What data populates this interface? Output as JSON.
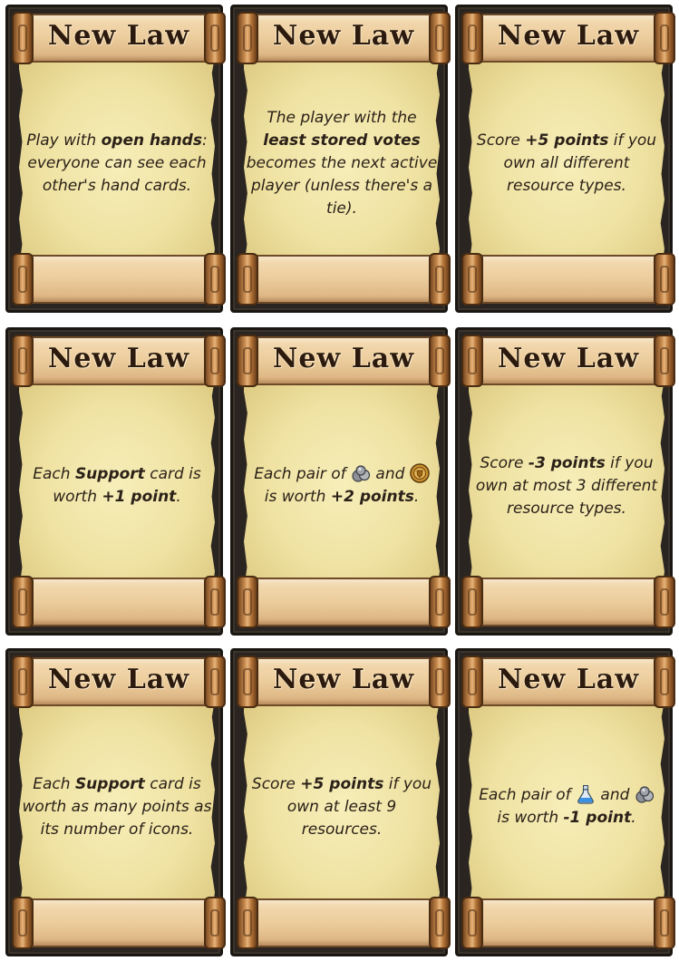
{
  "card_title": "New Law",
  "cards": [
    {
      "id": "c1",
      "t1": "Play with ",
      "b1": "open hands",
      "t2": ": everyone can see each other's hand cards."
    },
    {
      "id": "c2",
      "t1": "The player with the ",
      "b1": "least stored votes",
      "t2": " becomes the next active player (unless there's a tie)."
    },
    {
      "id": "c3",
      "t1": "Score ",
      "b1": "+5 points",
      "t2": " if you own all different resource types."
    },
    {
      "id": "c4",
      "t1": "Each ",
      "b1": "Support",
      "t2": " card is worth ",
      "b2": "+1 point",
      "t3": "."
    },
    {
      "id": "c5",
      "t1": "Each pair of ",
      "t2": " and ",
      "t3": " is worth ",
      "b1": "+2 points",
      "t4": ".",
      "icons": [
        "stone-icon",
        "coin-shield-icon"
      ]
    },
    {
      "id": "c6",
      "t1": "Score ",
      "b1": "-3 points",
      "t2": " if you own at most 3 different resource types."
    },
    {
      "id": "c7",
      "t1": "Each ",
      "b1": "Support",
      "t2": " card is worth as many points as its number of icons."
    },
    {
      "id": "c8",
      "t1": "Score ",
      "b1": "+5 points",
      "t2": " if you own at least 9 resources."
    },
    {
      "id": "c9",
      "t1": "Each pair of ",
      "t2": " and ",
      "t3": " is worth ",
      "b1": "-1 point",
      "t4": ".",
      "icons": [
        "potion-icon",
        "stone-icon"
      ]
    }
  ],
  "colors": {
    "frame": "#2a2520",
    "parchment": "#f3e8ad",
    "scroll": "#ecca9a",
    "ink": "#2b2118"
  }
}
